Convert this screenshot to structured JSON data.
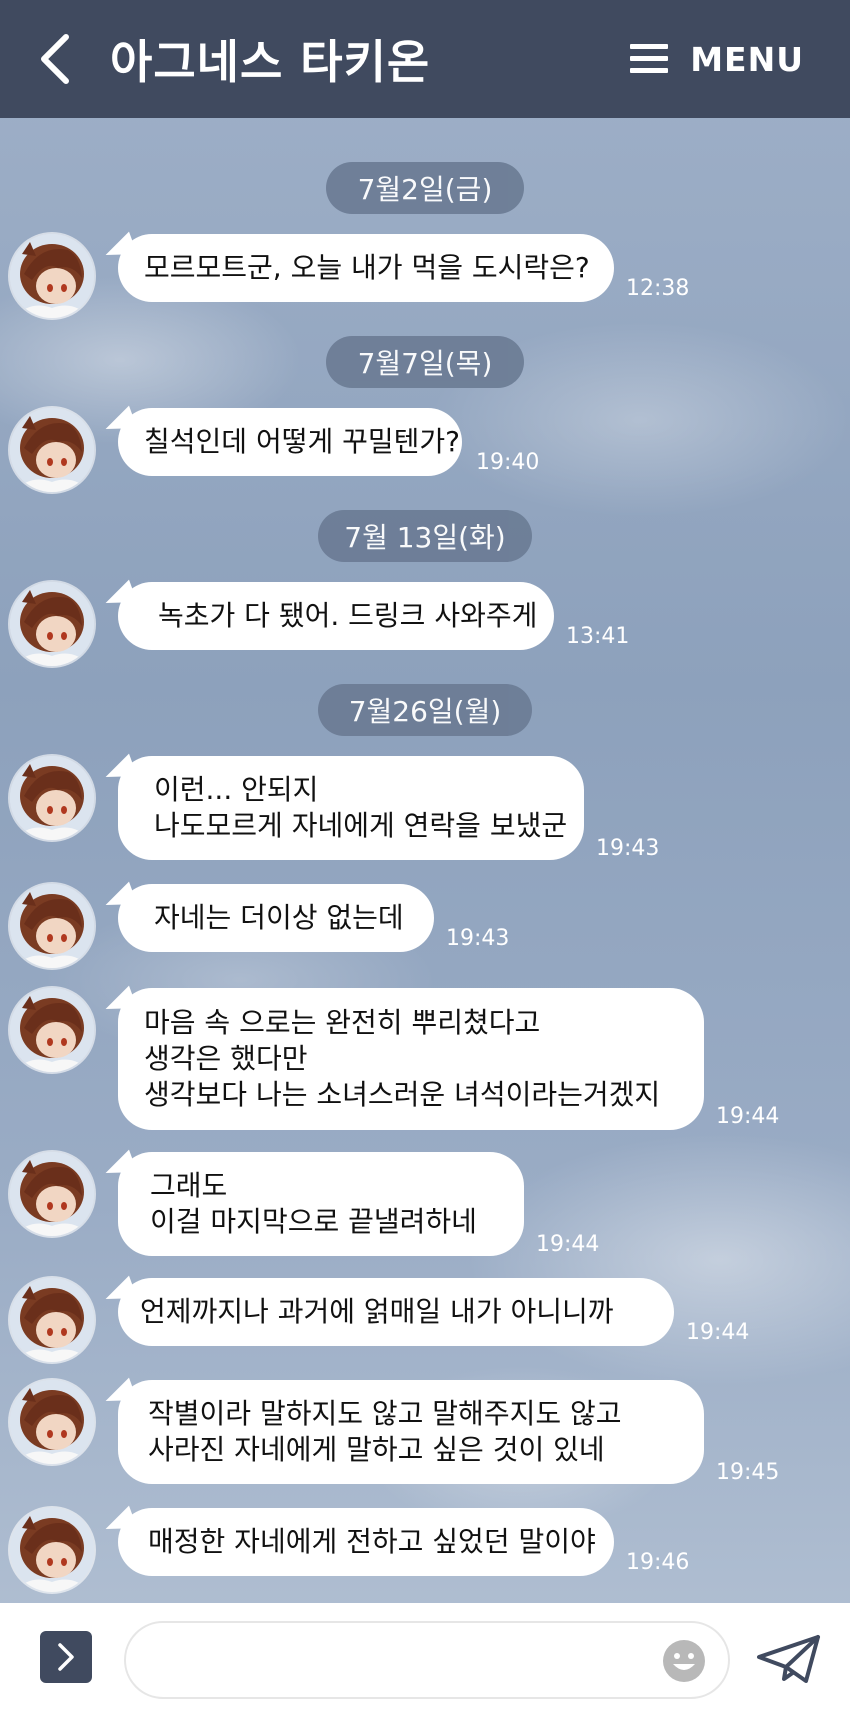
{
  "header": {
    "title": "아그네스 타키온",
    "menu_label": "MENU",
    "back_icon": "chevron-left-icon",
    "menu_icon": "hamburger-icon"
  },
  "colors": {
    "header_bg": "#404a5f",
    "date_pill_bg": "#6d7d96",
    "bubble_bg": "#ffffff",
    "text_on_dark": "#ffffff"
  },
  "dates": [
    "7월2일(금)",
    "7월7일(목)",
    "7월 13일(화)",
    "7월26일(월)"
  ],
  "messages": [
    {
      "lines": [
        "모르모트군, 오늘 내가 먹을 도시락은?"
      ],
      "time": "12:38"
    },
    {
      "lines": [
        "칠석인데  어떻게 꾸밀텐가?"
      ],
      "time": "19:40"
    },
    {
      "lines": [
        "녹초가 다 됐어. 드링크 사와주게"
      ],
      "time": "13:41"
    },
    {
      "lines": [
        "이런... 안되지",
        "나도모르게 자네에게 연락을 보냈군"
      ],
      "time": "19:43"
    },
    {
      "lines": [
        "자네는 더이상 없는데"
      ],
      "time": "19:43"
    },
    {
      "lines": [
        "마음 속 으로는 완전히 뿌리쳤다고",
        "생각은 했다만",
        "생각보다 나는 소녀스러운 녀석이라는거겠지"
      ],
      "time": "19:44"
    },
    {
      "lines": [
        "그래도",
        "이걸 마지막으로 끝낼려하네"
      ],
      "time": "19:44"
    },
    {
      "lines": [
        "언제까지나 과거에 얽매일 내가 아니니까"
      ],
      "time": "19:44"
    },
    {
      "lines": [
        "작별이라 말하지도 않고 말해주지도 않고",
        "사라진 자네에게 말하고 싶은 것이 있네"
      ],
      "time": "19:45"
    },
    {
      "lines": [
        "매정한 자네에게 전하고 싶었던 말이야"
      ],
      "time": "19:46"
    }
  ],
  "input": {
    "placeholder": "",
    "value": "",
    "expand_icon": "chevron-right-icon",
    "emoji_icon": "smiley-icon",
    "send_icon": "paper-plane-icon"
  }
}
